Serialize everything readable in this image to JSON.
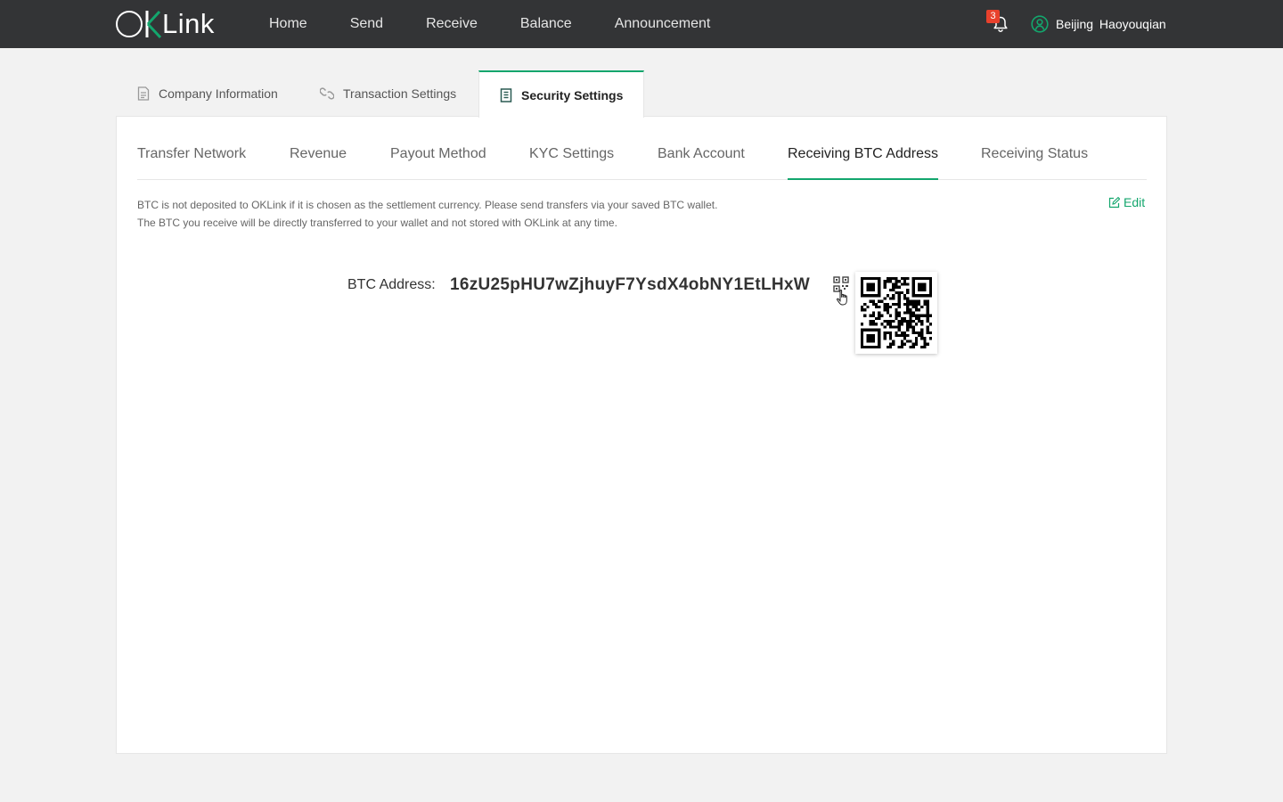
{
  "brand": {
    "logo_text": "Link",
    "logo_alt": "OKLink"
  },
  "nav": {
    "items": [
      {
        "label": "Home"
      },
      {
        "label": "Send"
      },
      {
        "label": "Receive"
      },
      {
        "label": "Balance"
      },
      {
        "label": "Announcement"
      }
    ]
  },
  "header": {
    "notification_count": "3",
    "user_name": "Beijing Haoyouqian"
  },
  "settings_tabs": [
    {
      "label": "Company Information",
      "icon": "document-icon",
      "active": false
    },
    {
      "label": "Transaction Settings",
      "icon": "link-icon",
      "active": false
    },
    {
      "label": "Security Settings",
      "icon": "shield-list-icon",
      "active": true
    }
  ],
  "subtabs": [
    {
      "label": "Transfer Network",
      "active": false
    },
    {
      "label": "Revenue",
      "active": false
    },
    {
      "label": "Payout Method",
      "active": false
    },
    {
      "label": "KYC Settings",
      "active": false
    },
    {
      "label": "Bank Account",
      "active": false
    },
    {
      "label": "Receiving BTC Address",
      "active": true
    },
    {
      "label": "Receiving Status",
      "active": false
    }
  ],
  "notice": {
    "line1": "BTC is not deposited to OKLink if it is chosen as the settlement currency. Please send transfers via your saved BTC wallet.",
    "line2": "The BTC you receive will be directly transferred to your wallet and not stored with OKLink at any time."
  },
  "edit_label": "Edit",
  "btc": {
    "label": "BTC Address:",
    "address": "16zU25pHU7wZjhuyF7YsdX4obNY1EtLHxW"
  },
  "colors": {
    "accent": "#13a66d",
    "topbar": "#333436",
    "badge": "#e8412c",
    "page_bg": "#f2f2f2"
  }
}
